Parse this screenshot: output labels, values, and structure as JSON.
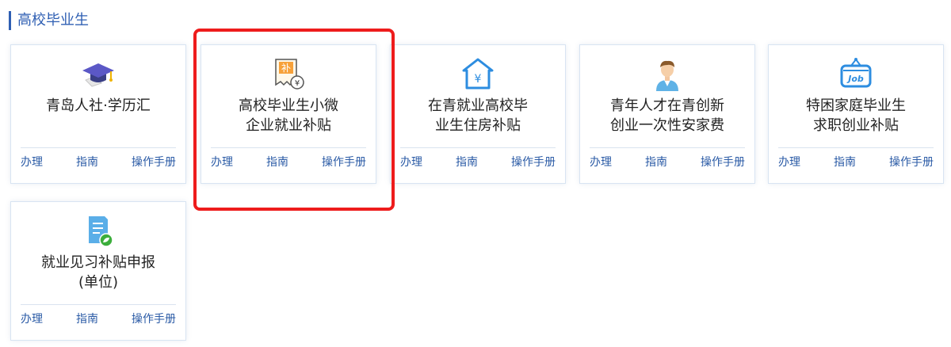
{
  "section": {
    "title": "高校毕业生"
  },
  "actions": {
    "handle": "办理",
    "guide": "指南",
    "manual": "操作手册"
  },
  "cards": [
    {
      "title_line1": "青岛人社·学历汇",
      "title_line2": "",
      "icon": "graduation-cap-icon"
    },
    {
      "title_line1": "高校毕业生小微",
      "title_line2": "企业就业补贴",
      "icon": "subsidy-receipt-icon"
    },
    {
      "title_line1": "在青就业高校毕",
      "title_line2": "业生住房补贴",
      "icon": "house-yen-icon"
    },
    {
      "title_line1": "青年人才在青创新",
      "title_line2": "创业一次性安家费",
      "icon": "young-man-icon"
    },
    {
      "title_line1": "特困家庭毕业生",
      "title_line2": "求职创业补贴",
      "icon": "job-sign-icon"
    },
    {
      "title_line1": "就业见习补贴申报",
      "title_line2": "(单位)",
      "icon": "document-leaf-icon"
    }
  ],
  "colors": {
    "accent": "#2f5fb3",
    "link": "#2b5ba6",
    "highlight": "#ee1c1c"
  }
}
